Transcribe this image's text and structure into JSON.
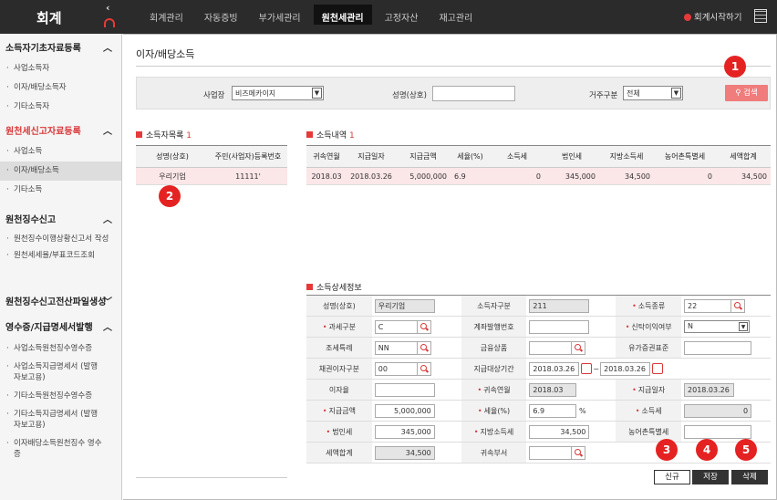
{
  "app": {
    "title": "회계",
    "collapse": "‹"
  },
  "top_menu": [
    "회계관리",
    "자동증빙",
    "부가세관리",
    "원천세관리",
    "고정자산",
    "재고관리"
  ],
  "top_menu_active": "원천세관리",
  "guide": "회계시작하기",
  "sidebar": [
    {
      "head": "소득자기초자료등록",
      "red": false,
      "items": [
        "사업소득자",
        "이자/배당소득자",
        "기타소득자"
      ]
    },
    {
      "head": "원천세신고자료등록",
      "red": true,
      "items": [
        "사업소득",
        "이자/배당소득",
        "기타소득"
      ],
      "selected": "이자/배당소득"
    },
    {
      "head": "원천징수신고",
      "red": false,
      "items": [
        "원천징수이행상황신고서 작성",
        "원천세세율/부표코드조회"
      ]
    },
    {
      "head": "원천징수신고전산파일생성",
      "red": false,
      "items": []
    },
    {
      "head": "영수증/지급명세서발행",
      "red": false,
      "items": [
        "사업소득원천징수영수증",
        "사업소득지급명세서 (발행자보고용)",
        "기타소득원천징수영수증",
        "기타소득지급명세서 (발행자보고용)",
        "이자배당소득원천징수 영수증"
      ]
    }
  ],
  "page_title": "이자/배당소득",
  "search": {
    "biz_label": "사업장",
    "biz_value": "비즈메카이지",
    "name_label": "성명(상호)",
    "name_value": "",
    "res_label": "거주구분",
    "res_value": "전체",
    "button": "검색"
  },
  "earner_list": {
    "title": "소득자목록",
    "count": "1",
    "columns": [
      "성명(상호)",
      "주민(사업자)등록번호"
    ],
    "rows": [
      [
        "우리기업",
        "11111'"
      ]
    ]
  },
  "income_list": {
    "title": "소득내역",
    "count": "1",
    "columns": [
      "귀속연월",
      "지급일자",
      "지급금액",
      "세율(%)",
      "소득세",
      "법인세",
      "지방소득세",
      "농어촌특별세",
      "세액합계"
    ],
    "rows": [
      [
        "2018.03",
        "2018.03.26",
        "5,000,000",
        "6.9",
        "0",
        "345,000",
        "34,500",
        "0",
        "34,500"
      ]
    ]
  },
  "detail": {
    "title": "소득상세정보",
    "name_k": "성명(상호)",
    "name_v": "우리기업",
    "earner_type_k": "소득자구분",
    "earner_type_v": "211",
    "income_type_k": "소득종류",
    "income_type_v": "22",
    "tax_class_k": "과세구분",
    "tax_class_v": "C",
    "account_k": "계좌발행번호",
    "account_v": "",
    "trust_k": "신탁이익여부",
    "trust_v": "N",
    "tax_special_k": "조세특례",
    "tax_special_v": "NN",
    "fin_product_k": "금융상품",
    "fin_product_v": "",
    "securities_k": "유가증권표준",
    "securities_v": "",
    "bond_k": "채권이자구분",
    "bond_v": "00",
    "period_k": "지급대상기간",
    "period_from": "2018.03.26",
    "period_sep": "~",
    "period_to": "2018.03.26",
    "interest_rate_k": "이자율",
    "interest_rate_v": "",
    "ym_k": "귀속연월",
    "ym_v": "2018.03",
    "paydate_k": "지급일자",
    "paydate_v": "2018.03.26",
    "pay_amt_k": "지급금액",
    "pay_amt_v": "5,000,000",
    "rate_k": "세율(%)",
    "rate_v": "6.9",
    "rate_unit": "%",
    "income_tax_k": "소득세",
    "income_tax_v": "0",
    "corp_tax_k": "법인세",
    "corp_tax_v": "345,000",
    "local_tax_k": "지방소득세",
    "local_tax_v": "34,500",
    "rural_tax_k": "농어촌특별세",
    "rural_tax_v": "",
    "total_k": "세액합계",
    "total_v": "34,500",
    "dept_k": "귀속부서",
    "dept_v": ""
  },
  "buttons": {
    "new": "신규",
    "save": "저장",
    "delete": "삭제"
  },
  "badges": [
    "1",
    "2",
    "3",
    "4",
    "5"
  ],
  "colors": {
    "accent": "#d9383a",
    "search_btn": "#f07c7c",
    "topbar": "#2b2b2b",
    "badge": "#e52222"
  }
}
